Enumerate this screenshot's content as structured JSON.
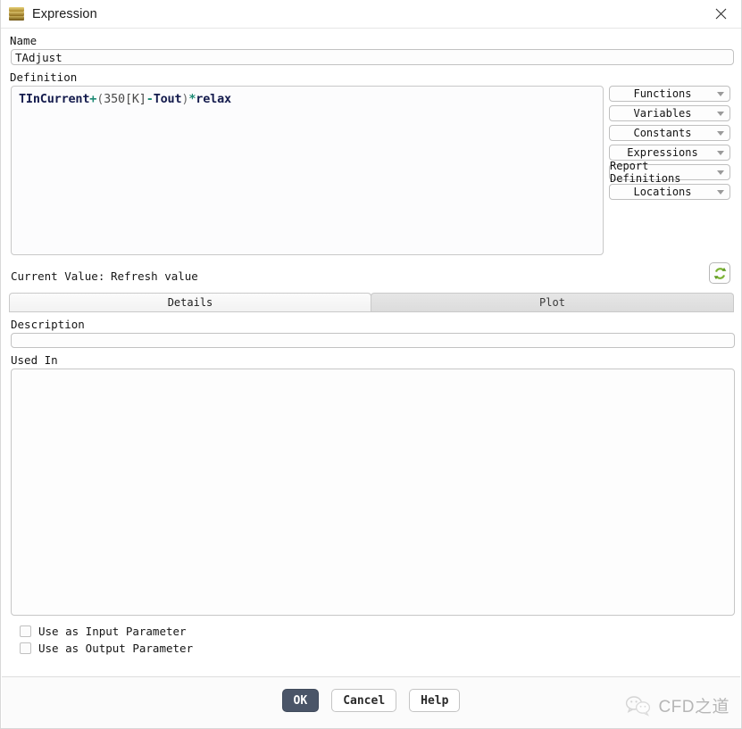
{
  "window": {
    "title": "Expression",
    "icon": "expression-stack-icon",
    "close_label": "✕"
  },
  "form": {
    "name_label": "Name",
    "name_value": "TAdjust",
    "definition_label": "Definition",
    "definition_text": "TInCurrent+(350[K]-Tout)*relax",
    "definition_tokens": [
      {
        "text": "TInCurrent",
        "kind": "ident"
      },
      {
        "text": "+",
        "kind": "op"
      },
      {
        "text": "(",
        "kind": "paren"
      },
      {
        "text": "350",
        "kind": "num"
      },
      {
        "text": "[K]",
        "kind": "unit"
      },
      {
        "text": "-",
        "kind": "op"
      },
      {
        "text": "Tout",
        "kind": "ident"
      },
      {
        "text": ")",
        "kind": "paren"
      },
      {
        "text": "*",
        "kind": "op"
      },
      {
        "text": "relax",
        "kind": "ident"
      }
    ]
  },
  "insert_menus": [
    {
      "label": "Functions",
      "icon": "chevron-down-icon"
    },
    {
      "label": "Variables",
      "icon": "chevron-down-icon"
    },
    {
      "label": "Constants",
      "icon": "chevron-down-icon"
    },
    {
      "label": "Expressions",
      "icon": "chevron-down-icon"
    },
    {
      "label": "Report Definitions",
      "icon": "chevron-down-icon"
    },
    {
      "label": "Locations",
      "icon": "chevron-down-icon"
    }
  ],
  "current_value": {
    "label": "Current Value:",
    "value_text": "Refresh value",
    "refresh_icon": "refresh-icon"
  },
  "tabs": [
    {
      "label": "Details",
      "active": true
    },
    {
      "label": "Plot",
      "active": false
    }
  ],
  "details": {
    "description_label": "Description",
    "description_value": "",
    "description_placeholder": "",
    "used_in_label": "Used In",
    "used_in_items": []
  },
  "checkboxes": [
    {
      "label": "Use as Input Parameter",
      "checked": false
    },
    {
      "label": "Use as Output Parameter",
      "checked": false
    }
  ],
  "footer": {
    "ok_label": "OK",
    "cancel_label": "Cancel",
    "help_label": "Help"
  },
  "watermark": {
    "text": "CFD之道",
    "icon": "wechat-bubbles-icon"
  },
  "colors": {
    "accent_primary": "#4a5568",
    "identifier": "#141b4d",
    "operator": "#1d8a74",
    "refresh_green": "#6aa82b",
    "tab_active_bg": "#f6f6f6",
    "tab_inactive_bg": "#e1e1e1"
  }
}
